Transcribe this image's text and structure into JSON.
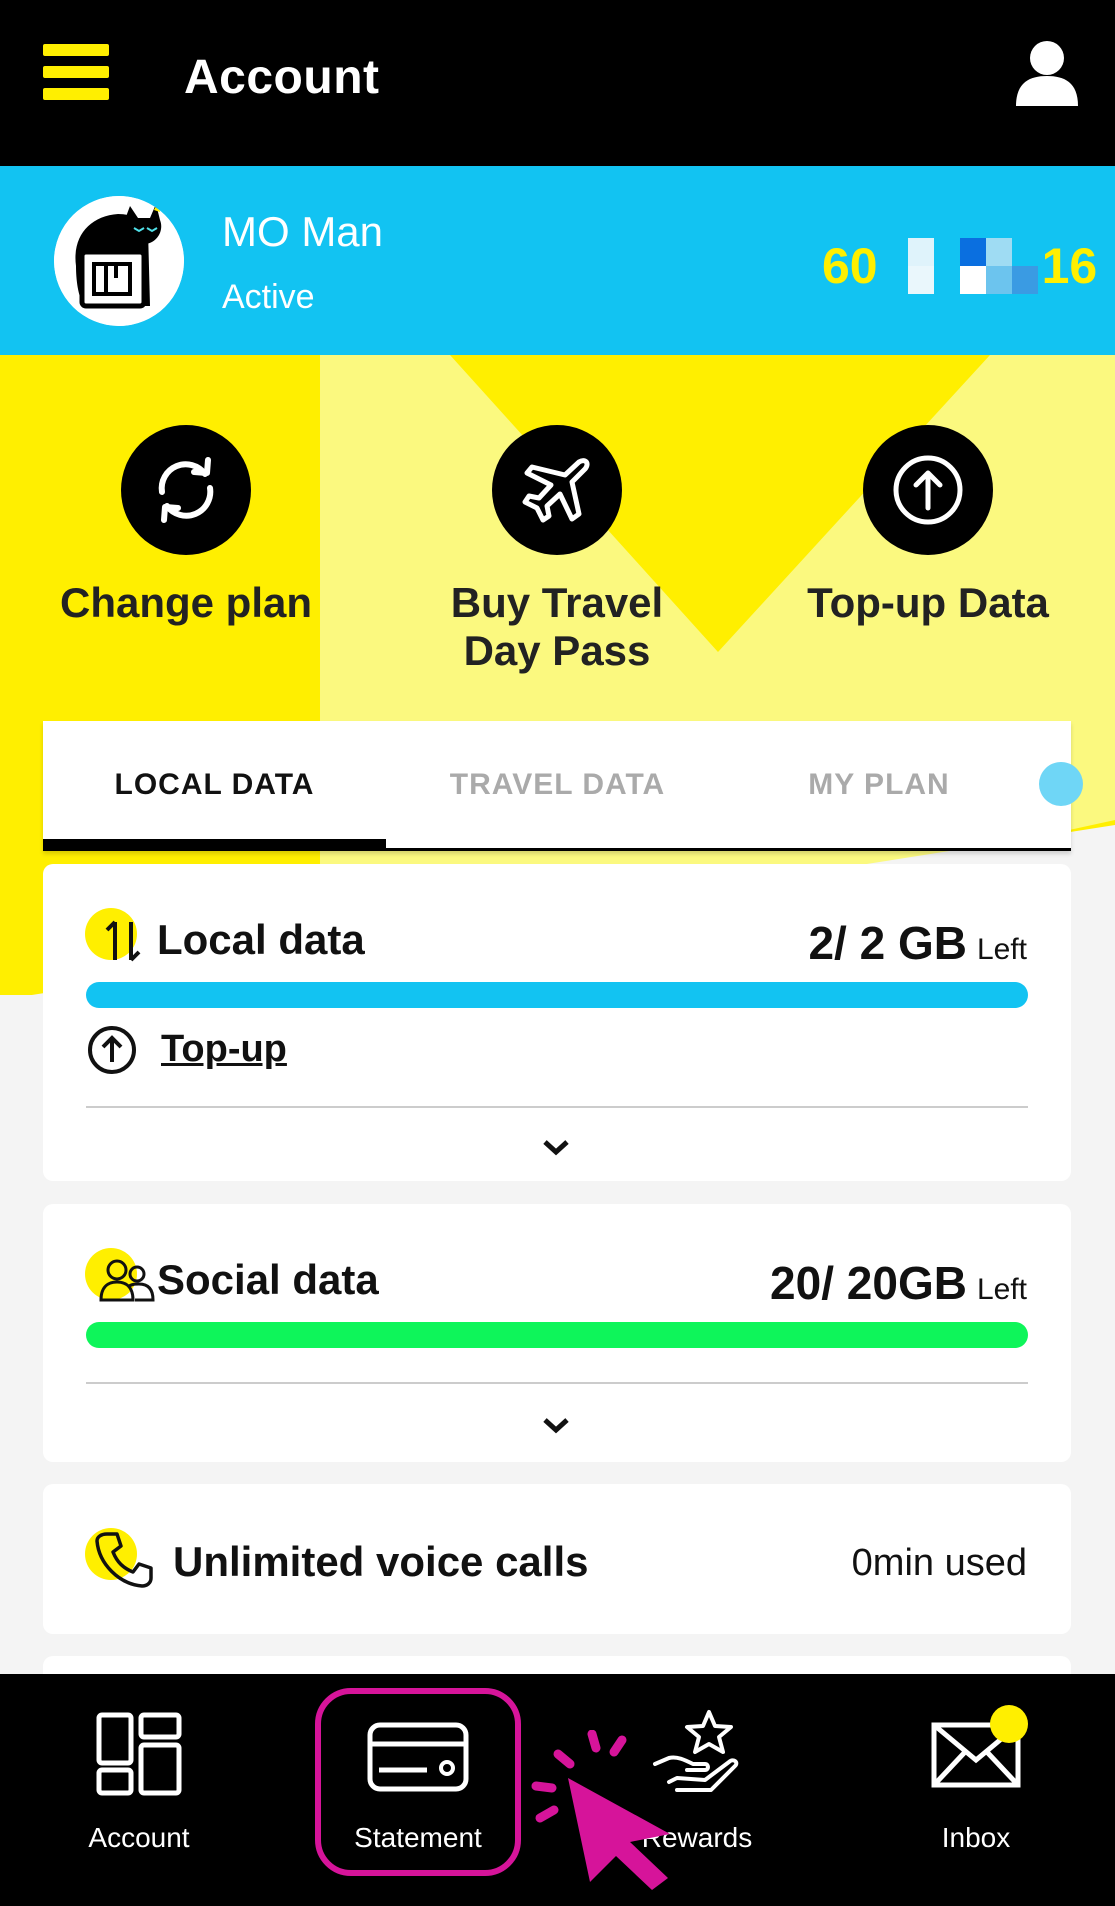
{
  "header": {
    "title": "Account",
    "menu_icon": "hamburger-menu-icon",
    "profile_icon": "user-profile-icon"
  },
  "user": {
    "name": "MO Man",
    "status": "Active",
    "phone_prefix": "60",
    "phone_suffix": "16"
  },
  "actions": [
    {
      "label": "Change plan",
      "icon": "refresh-icon"
    },
    {
      "label": "Buy Travel Day Pass",
      "icon": "airplane-icon"
    },
    {
      "label": "Top-up Data",
      "icon": "upload-circle-icon"
    }
  ],
  "tabs": [
    {
      "label": "LOCAL DATA",
      "active": true
    },
    {
      "label": "TRAVEL DATA",
      "active": false
    },
    {
      "label": "MY PLAN",
      "active": false
    }
  ],
  "cards": {
    "local": {
      "title": "Local data",
      "value": "2/ 2 GB",
      "unit_suffix": "Left",
      "remaining_fraction": 1.0,
      "topup_label": "Top-up",
      "bar_color": "#12c3f2"
    },
    "social": {
      "title": "Social data",
      "value": "20/ 20GB",
      "unit_suffix": "Left",
      "remaining_fraction": 1.0,
      "bar_color": "#0ef55a"
    },
    "voice": {
      "title": "Unlimited voice calls",
      "value": "0min used"
    }
  },
  "bottom_nav": [
    {
      "label": "Account",
      "icon": "dashboard-icon"
    },
    {
      "label": "Statement",
      "icon": "credit-card-icon",
      "highlighted": true
    },
    {
      "label": "Rewards",
      "icon": "rewards-hand-star-icon"
    },
    {
      "label": "Inbox",
      "icon": "envelope-icon",
      "badge": true
    }
  ],
  "colors": {
    "brand_yellow": "#ffef00",
    "brand_blue": "#12c3f2",
    "highlight_magenta": "#d6149a",
    "social_green": "#0ef55a"
  }
}
